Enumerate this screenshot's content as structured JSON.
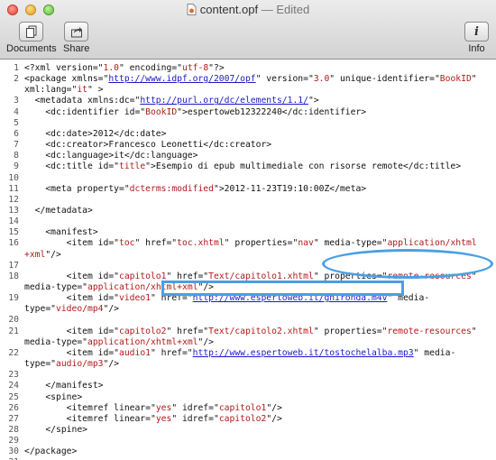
{
  "window": {
    "filename": "content.opf",
    "status": " — Edited",
    "toolbar": {
      "documents_label": "Documents",
      "share_label": "Share",
      "info_label": "Info"
    },
    "icons": [
      "documents-icon",
      "share-icon",
      "info-icon",
      "file-icon"
    ]
  },
  "editor": {
    "lines": [
      {
        "n": "1",
        "parts": [
          {
            "t": "<?xml version=\"",
            "c": ""
          },
          {
            "t": "1.0",
            "c": "s"
          },
          {
            "t": "\" encoding=\"",
            "c": ""
          },
          {
            "t": "utf-8",
            "c": "s"
          },
          {
            "t": "\"?>",
            "c": ""
          }
        ]
      },
      {
        "n": "2",
        "parts": [
          {
            "t": "<package xmlns=\"",
            "c": ""
          },
          {
            "t": "http://www.idpf.org/2007/opf",
            "c": "u"
          },
          {
            "t": "\" version=\"",
            "c": ""
          },
          {
            "t": "3.0",
            "c": "s"
          },
          {
            "t": "\" unique-identifier=\"",
            "c": ""
          },
          {
            "t": "BookID",
            "c": "s"
          },
          {
            "t": "\"",
            "c": ""
          }
        ]
      },
      {
        "n": "",
        "parts": [
          {
            "t": "xml:lang=\"",
            "c": ""
          },
          {
            "t": "it",
            "c": "s"
          },
          {
            "t": "\" >",
            "c": ""
          }
        ]
      },
      {
        "n": "3",
        "parts": [
          {
            "t": "  <metadata xmlns:dc=\"",
            "c": ""
          },
          {
            "t": "http://purl.org/dc/elements/1.1/",
            "c": "u"
          },
          {
            "t": "\">",
            "c": ""
          }
        ]
      },
      {
        "n": "4",
        "parts": [
          {
            "t": "    <dc:identifier id=\"",
            "c": ""
          },
          {
            "t": "BookID",
            "c": "s"
          },
          {
            "t": "\">espertoweb12322240</dc:identifier>",
            "c": ""
          }
        ]
      },
      {
        "n": "5",
        "parts": []
      },
      {
        "n": "6",
        "parts": [
          {
            "t": "    <dc:date>2012</dc:date>",
            "c": ""
          }
        ]
      },
      {
        "n": "7",
        "parts": [
          {
            "t": "    <dc:creator>Francesco Leonetti</dc:creator>",
            "c": ""
          }
        ]
      },
      {
        "n": "8",
        "parts": [
          {
            "t": "    <dc:language>it</dc:language>",
            "c": ""
          }
        ]
      },
      {
        "n": "9",
        "parts": [
          {
            "t": "    <dc:title id=\"",
            "c": ""
          },
          {
            "t": "title",
            "c": "s"
          },
          {
            "t": "\">Esempio di epub multimediale con risorse remote</dc:title>",
            "c": ""
          }
        ]
      },
      {
        "n": "10",
        "parts": []
      },
      {
        "n": "11",
        "parts": [
          {
            "t": "    <meta property=\"",
            "c": ""
          },
          {
            "t": "dcterms:modified",
            "c": "s"
          },
          {
            "t": "\">2012-11-23T19:10:00Z</meta>",
            "c": ""
          }
        ]
      },
      {
        "n": "12",
        "parts": []
      },
      {
        "n": "13",
        "parts": [
          {
            "t": "  </metadata>",
            "c": ""
          }
        ]
      },
      {
        "n": "14",
        "parts": []
      },
      {
        "n": "15",
        "parts": [
          {
            "t": "    <manifest>",
            "c": ""
          }
        ]
      },
      {
        "n": "16",
        "parts": [
          {
            "t": "        <item id=\"",
            "c": ""
          },
          {
            "t": "toc",
            "c": "s"
          },
          {
            "t": "\" href=\"",
            "c": ""
          },
          {
            "t": "toc.xhtml",
            "c": "s"
          },
          {
            "t": "\" properties=\"",
            "c": ""
          },
          {
            "t": "nav",
            "c": "s"
          },
          {
            "t": "\" media-type=\"",
            "c": ""
          },
          {
            "t": "application/xhtml",
            "c": "s"
          }
        ]
      },
      {
        "n": "",
        "parts": [
          {
            "t": "+xml",
            "c": "s"
          },
          {
            "t": "\"/>",
            "c": ""
          }
        ]
      },
      {
        "n": "17",
        "parts": []
      },
      {
        "n": "18",
        "parts": [
          {
            "t": "        <item id=\"",
            "c": ""
          },
          {
            "t": "capitolo1",
            "c": "s"
          },
          {
            "t": "\" href=\"",
            "c": ""
          },
          {
            "t": "Text/capitolo1.xhtml",
            "c": "s"
          },
          {
            "t": "\" properties=\"",
            "c": ""
          },
          {
            "t": "remote-resources",
            "c": "s"
          },
          {
            "t": "\"",
            "c": ""
          }
        ]
      },
      {
        "n": "",
        "parts": [
          {
            "t": "media-type=\"",
            "c": ""
          },
          {
            "t": "application/xhtml+xml",
            "c": "s"
          },
          {
            "t": "\"/>",
            "c": ""
          }
        ]
      },
      {
        "n": "19",
        "parts": [
          {
            "t": "        <item id=\"",
            "c": ""
          },
          {
            "t": "video1",
            "c": "s"
          },
          {
            "t": "\" href=\"",
            "c": ""
          },
          {
            "t": "http://www.espertoweb.it/ghironda.m4v",
            "c": "u"
          },
          {
            "t": "\" media-",
            "c": ""
          }
        ]
      },
      {
        "n": "",
        "parts": [
          {
            "t": "type=\"",
            "c": ""
          },
          {
            "t": "video/mp4",
            "c": "s"
          },
          {
            "t": "\"/>",
            "c": ""
          }
        ]
      },
      {
        "n": "20",
        "parts": []
      },
      {
        "n": "21",
        "parts": [
          {
            "t": "        <item id=\"",
            "c": ""
          },
          {
            "t": "capitolo2",
            "c": "s"
          },
          {
            "t": "\" href=\"",
            "c": ""
          },
          {
            "t": "Text/capitolo2.xhtml",
            "c": "s"
          },
          {
            "t": "\" properties=\"",
            "c": ""
          },
          {
            "t": "remote-resources",
            "c": "s"
          },
          {
            "t": "\"",
            "c": ""
          }
        ]
      },
      {
        "n": "",
        "parts": [
          {
            "t": "media-type=\"",
            "c": ""
          },
          {
            "t": "application/xhtml+xml",
            "c": "s"
          },
          {
            "t": "\"/>",
            "c": ""
          }
        ]
      },
      {
        "n": "22",
        "parts": [
          {
            "t": "        <item id=\"",
            "c": ""
          },
          {
            "t": "audio1",
            "c": "s"
          },
          {
            "t": "\" href=\"",
            "c": ""
          },
          {
            "t": "http://www.espertoweb.it/tostochelalba.mp3",
            "c": "u"
          },
          {
            "t": "\" media-",
            "c": ""
          }
        ]
      },
      {
        "n": "",
        "parts": [
          {
            "t": "type=\"",
            "c": ""
          },
          {
            "t": "audio/mp3",
            "c": "s"
          },
          {
            "t": "\"/>",
            "c": ""
          }
        ]
      },
      {
        "n": "23",
        "parts": []
      },
      {
        "n": "24",
        "parts": [
          {
            "t": "    </manifest>",
            "c": ""
          }
        ]
      },
      {
        "n": "25",
        "parts": [
          {
            "t": "    <spine>",
            "c": ""
          }
        ]
      },
      {
        "n": "26",
        "parts": [
          {
            "t": "        <itemref linear=\"",
            "c": ""
          },
          {
            "t": "yes",
            "c": "s"
          },
          {
            "t": "\" idref=\"",
            "c": ""
          },
          {
            "t": "capitolo1",
            "c": "s"
          },
          {
            "t": "\"/>",
            "c": ""
          }
        ]
      },
      {
        "n": "27",
        "parts": [
          {
            "t": "        <itemref linear=\"",
            "c": ""
          },
          {
            "t": "yes",
            "c": "s"
          },
          {
            "t": "\" idref=\"",
            "c": ""
          },
          {
            "t": "capitolo2",
            "c": "s"
          },
          {
            "t": "\"/>",
            "c": ""
          }
        ]
      },
      {
        "n": "28",
        "parts": [
          {
            "t": "    </spine>",
            "c": ""
          }
        ]
      },
      {
        "n": "29",
        "parts": []
      },
      {
        "n": "30",
        "parts": [
          {
            "t": "</package>",
            "c": ""
          }
        ]
      },
      {
        "n": "31",
        "parts": []
      }
    ]
  },
  "colors": {
    "string": "#b0191b",
    "link": "#1a1ac8",
    "highlight": "#4a9fe4"
  }
}
